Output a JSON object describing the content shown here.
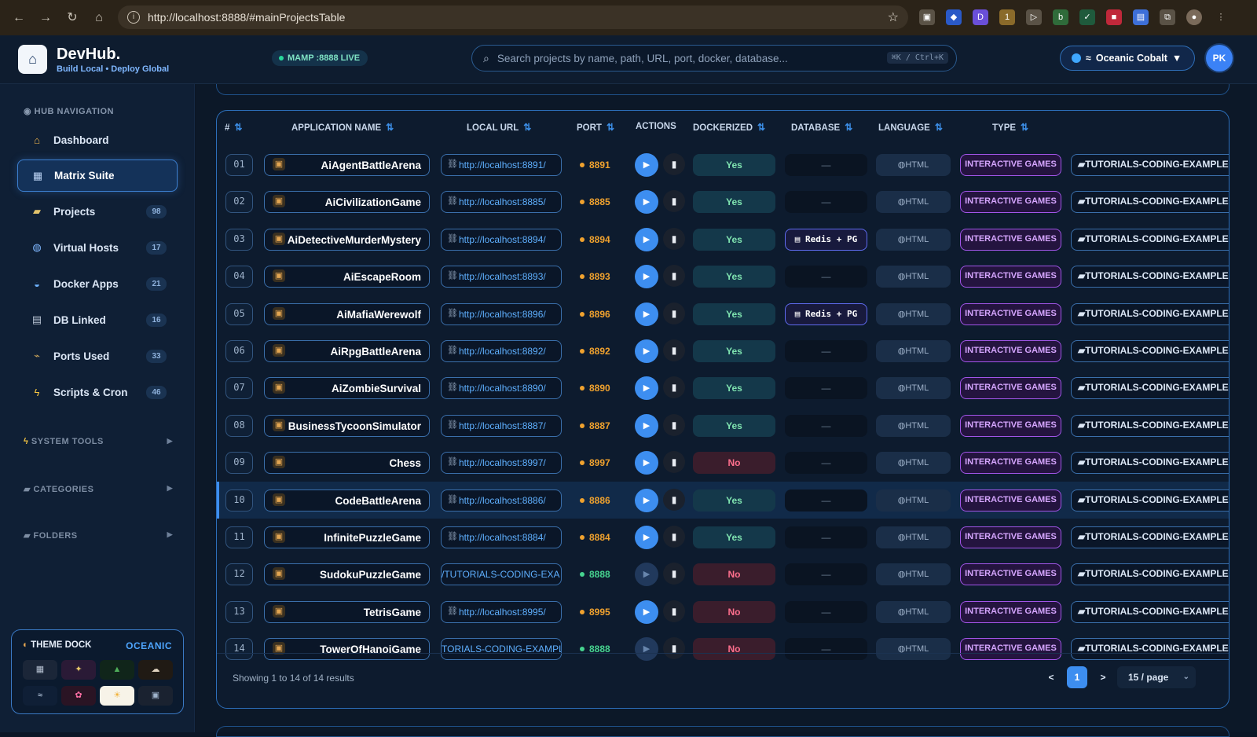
{
  "browser": {
    "url": "http://localhost:8888/#mainProjectsTable"
  },
  "header": {
    "brand_name": "DevHub.",
    "brand_tagline": "Build Local • Deploy Global",
    "live_label": "MAMP :8888 LIVE",
    "search_placeholder": "Search projects by name, path, URL, port, docker, database...",
    "search_shortcut": "⌘K / Ctrl+K",
    "theme_label": "Oceanic Cobalt",
    "avatar_initials": "PK"
  },
  "sidebar": {
    "nav_title": "HUB NAVIGATION",
    "items": [
      {
        "label": "Dashboard",
        "icon": "home-icon",
        "count": ""
      },
      {
        "label": "Matrix Suite",
        "icon": "grid-icon",
        "count": ""
      },
      {
        "label": "Projects",
        "icon": "folder-icon",
        "count": "98"
      },
      {
        "label": "Virtual Hosts",
        "icon": "globe-icon",
        "count": "17"
      },
      {
        "label": "Docker Apps",
        "icon": "whale-icon",
        "count": "21"
      },
      {
        "label": "DB Linked",
        "icon": "database-icon",
        "count": "16"
      },
      {
        "label": "Ports Used",
        "icon": "plug-icon",
        "count": "33"
      },
      {
        "label": "Scripts & Cron",
        "icon": "bolt-icon",
        "count": "46"
      }
    ],
    "sections": [
      "SYSTEM TOOLS",
      "CATEGORIES",
      "FOLDERS"
    ],
    "theme_dock_title": "THEME DOCK",
    "theme_dock_current": "OCEANIC"
  },
  "table": {
    "headers": {
      "num": "#",
      "name": "APPLICATION NAME",
      "url": "LOCAL URL",
      "port": "PORT",
      "actions": "ACTIONS",
      "dockerized": "DOCKERIZED",
      "database": "DATABASE",
      "language": "LANGUAGE",
      "type": "TYPE"
    },
    "rows": [
      {
        "num": "01",
        "name": "AiAgentBattleArena",
        "url": "http://localhost:8891/",
        "port": "8891",
        "docker": "Yes",
        "db": "—",
        "lang": "HTML",
        "type": "INTERACTIVE GAMES",
        "folder": "TUTORIALS-CODING-EXAMPLES"
      },
      {
        "num": "02",
        "name": "AiCivilizationGame",
        "url": "http://localhost:8885/",
        "port": "8885",
        "docker": "Yes",
        "db": "—",
        "lang": "HTML",
        "type": "INTERACTIVE GAMES",
        "folder": "TUTORIALS-CODING-EXAMPLES"
      },
      {
        "num": "03",
        "name": "AiDetectiveMurderMystery",
        "url": "http://localhost:8894/",
        "port": "8894",
        "docker": "Yes",
        "db": "Redis + PG",
        "lang": "HTML",
        "type": "INTERACTIVE GAMES",
        "folder": "TUTORIALS-CODING-EXAMPLES"
      },
      {
        "num": "04",
        "name": "AiEscapeRoom",
        "url": "http://localhost:8893/",
        "port": "8893",
        "docker": "Yes",
        "db": "—",
        "lang": "HTML",
        "type": "INTERACTIVE GAMES",
        "folder": "TUTORIALS-CODING-EXAMPLES"
      },
      {
        "num": "05",
        "name": "AiMafiaWerewolf",
        "url": "http://localhost:8896/",
        "port": "8896",
        "docker": "Yes",
        "db": "Redis + PG",
        "lang": "HTML",
        "type": "INTERACTIVE GAMES",
        "folder": "TUTORIALS-CODING-EXAMPLES"
      },
      {
        "num": "06",
        "name": "AiRpgBattleArena",
        "url": "http://localhost:8892/",
        "port": "8892",
        "docker": "Yes",
        "db": "—",
        "lang": "HTML",
        "type": "INTERACTIVE GAMES",
        "folder": "TUTORIALS-CODING-EXAMPLES"
      },
      {
        "num": "07",
        "name": "AiZombieSurvival",
        "url": "http://localhost:8890/",
        "port": "8890",
        "docker": "Yes",
        "db": "—",
        "lang": "HTML",
        "type": "INTERACTIVE GAMES",
        "folder": "TUTORIALS-CODING-EXAMPLES"
      },
      {
        "num": "08",
        "name": "BusinessTycoonSimulator",
        "url": "http://localhost:8887/",
        "port": "8887",
        "docker": "Yes",
        "db": "—",
        "lang": "HTML",
        "type": "INTERACTIVE GAMES",
        "folder": "TUTORIALS-CODING-EXAMPLES"
      },
      {
        "num": "09",
        "name": "Chess",
        "url": "http://localhost:8997/",
        "port": "8997",
        "docker": "No",
        "db": "—",
        "lang": "HTML",
        "type": "INTERACTIVE GAMES",
        "folder": "TUTORIALS-CODING-EXAMPLES"
      },
      {
        "num": "10",
        "name": "CodeBattleArena",
        "url": "http://localhost:8886/",
        "port": "8886",
        "docker": "Yes",
        "db": "—",
        "lang": "HTML",
        "type": "INTERACTIVE GAMES",
        "folder": "TUTORIALS-CODING-EXAMPLES"
      },
      {
        "num": "11",
        "name": "InfinitePuzzleGame",
        "url": "http://localhost:8884/",
        "port": "8884",
        "docker": "Yes",
        "db": "—",
        "lang": "HTML",
        "type": "INTERACTIVE GAMES",
        "folder": "TUTORIALS-CODING-EXAMPLES"
      },
      {
        "num": "12",
        "name": "SudokuPuzzleGame",
        "url": "/TUTORIALS-CODING-EXA",
        "port": "8888",
        "docker": "No",
        "db": "—",
        "lang": "HTML",
        "type": "INTERACTIVE GAMES",
        "folder": "TUTORIALS-CODING-EXAMPLES"
      },
      {
        "num": "13",
        "name": "TetrisGame",
        "url": "http://localhost:8995/",
        "port": "8995",
        "docker": "No",
        "db": "—",
        "lang": "HTML",
        "type": "INTERACTIVE GAMES",
        "folder": "TUTORIALS-CODING-EXAMPLES"
      },
      {
        "num": "14",
        "name": "TowerOfHanoiGame",
        "url": "TORIALS-CODING-EXAMPL",
        "port": "8888",
        "docker": "No",
        "db": "—",
        "lang": "HTML",
        "type": "INTERACTIVE GAMES",
        "folder": "TUTORIALS-CODING-EXAMPLES"
      }
    ],
    "footer_text": "Showing 1 to 14 of 14 results",
    "current_page": "1",
    "per_page": "15 / page"
  }
}
